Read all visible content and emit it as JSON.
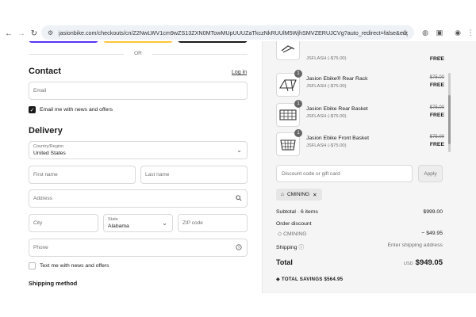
{
  "browser": {
    "url": "jasionbike.com/checkouts/cn/Z2NwLWV1cm9wZS13ZXN0MTowMUpUUUZaTkczNkRUUlM5WjhSMVZERUJCVg?auto_redirect=false&edge_redire..."
  },
  "express": {
    "or_text": "OR"
  },
  "contact": {
    "title": "Contact",
    "login_link": "Log in",
    "email_placeholder": "Email",
    "news_label": "Email me with news and offers"
  },
  "delivery": {
    "title": "Delivery",
    "country_label": "Country/Region",
    "country_value": "United States",
    "first_name_placeholder": "First name",
    "last_name_placeholder": "Last name",
    "address_placeholder": "Address",
    "city_placeholder": "City",
    "state_label": "State",
    "state_value": "Alabama",
    "zip_placeholder": "ZIP code",
    "phone_placeholder": "Phone",
    "text_label": "Text me with news and offers",
    "shipping_method_title": "Shipping method"
  },
  "cart": {
    "items": [
      {
        "name": "",
        "discount": "JSFLASH (-$75.00)",
        "original": "",
        "price": "FREE",
        "qty": ""
      },
      {
        "name": "Jasion Ebike® Rear Rack",
        "discount": "JSFLASH (-$75.00)",
        "original": "$75.00",
        "price": "FREE",
        "qty": "1"
      },
      {
        "name": "Jasion Ebike Rear Basket",
        "discount": "JSFLASH (-$75.00)",
        "original": "$75.00",
        "price": "FREE",
        "qty": "1"
      },
      {
        "name": "Jasion Ebike Front Basket",
        "discount": "JSFLASH (-$75.00)",
        "original": "$75.00",
        "price": "FREE",
        "qty": "1"
      }
    ],
    "discount_placeholder": "Discount code or gift card",
    "apply_label": "Apply",
    "applied_code": "CMINING",
    "subtotal_label": "Subtotal · 6 items",
    "subtotal_value": "$999.00",
    "order_discount_label": "Order discount",
    "order_discount_code": "CMINING",
    "order_discount_value": "− $49.95",
    "shipping_label": "Shipping",
    "shipping_value": "Enter shipping address",
    "total_label": "Total",
    "total_currency": "USD",
    "total_value": "$949.05",
    "savings_label": "TOTAL SAVINGS",
    "savings_value": "$564.95"
  }
}
